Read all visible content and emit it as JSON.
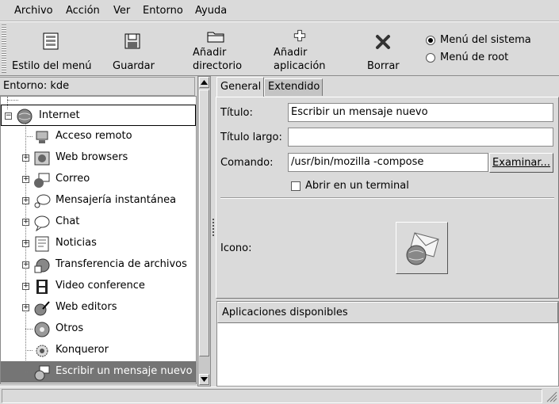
{
  "menubar": [
    "Archivo",
    "Acción",
    "Ver",
    "Entorno",
    "Ayuda"
  ],
  "toolbar": {
    "menu_style": "Estilo del menú",
    "save": "Guardar",
    "add_dir_1": "Añadir",
    "add_dir_2": "directorio",
    "add_app_1": "Añadir",
    "add_app_2": "aplicación",
    "delete": "Borrar",
    "radio_system": "Menú del sistema",
    "radio_root": "Menú de root",
    "radio_selected": "system"
  },
  "left": {
    "environment_label": "Entorno: kde",
    "tree": [
      {
        "label": "Internet",
        "icon": "globe-icon",
        "expanded": true,
        "level": 0
      },
      {
        "label": "Acceso remoto",
        "icon": "remote-access-icon",
        "level": 1
      },
      {
        "label": "Web browsers",
        "icon": "web-browser-icon",
        "level": 1,
        "expander": true
      },
      {
        "label": "Correo",
        "icon": "mail-icon",
        "level": 1,
        "expander": true
      },
      {
        "label": "Mensajería instantánea",
        "icon": "chat-bubble-icon",
        "level": 1,
        "expander": true
      },
      {
        "label": "Chat",
        "icon": "chat-icon",
        "level": 1,
        "expander": true
      },
      {
        "label": "Noticias",
        "icon": "news-icon",
        "level": 1,
        "expander": true
      },
      {
        "label": "Transferencia de archivos",
        "icon": "file-transfer-icon",
        "level": 1,
        "expander": true
      },
      {
        "label": "Video conference",
        "icon": "film-icon",
        "level": 1,
        "expander": true
      },
      {
        "label": "Web editors",
        "icon": "web-editor-icon",
        "level": 1,
        "expander": true
      },
      {
        "label": "Otros",
        "icon": "misc-icon",
        "level": 1
      },
      {
        "label": "Konqueror",
        "icon": "konqueror-icon",
        "level": 1
      },
      {
        "label": "Escribir un mensaje nuevo",
        "icon": "compose-mail-icon",
        "level": 1,
        "selected": true
      }
    ]
  },
  "tabs": {
    "general": "General",
    "extended": "Extendido"
  },
  "form": {
    "title_label": "Título:",
    "title_value": "Escribir un mensaje nuevo",
    "long_title_label": "Título largo:",
    "long_title_value": "",
    "command_label": "Comando:",
    "command_value": "/usr/bin/mozilla -compose",
    "browse_button": "Examinar...",
    "terminal_label": "Abrir en un terminal",
    "terminal_checked": false,
    "icon_label": "Icono:"
  },
  "apps": {
    "header": "Aplicaciones disponibles"
  },
  "colors": {
    "selection_bg": "#757575",
    "selection_fg": "#ffffff",
    "window_bg": "#dadada"
  }
}
